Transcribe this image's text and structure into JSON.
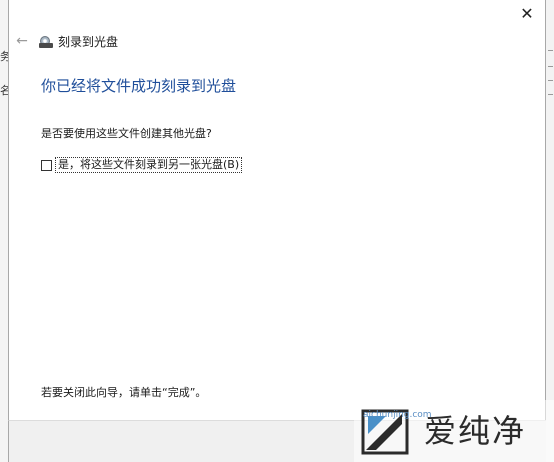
{
  "background": {
    "left_fragments": [
      "务",
      "名"
    ]
  },
  "dialog": {
    "close_label": "✕",
    "back_label": "←",
    "title": "刻录到光盘",
    "heading": "你已经将文件成功刻录到光盘",
    "question": "是否要使用这些文件创建其他光盘?",
    "option_label": "是，将这些文件刻录到另一张光盘(B)",
    "footer": "若要关闭此向导，请单击“完成”。"
  },
  "watermark": {
    "brand": "爱纯净",
    "url": "aichunjing.com"
  },
  "colors": {
    "heading": "#1f4e9a",
    "watermark_url": "#5b8fc4"
  }
}
